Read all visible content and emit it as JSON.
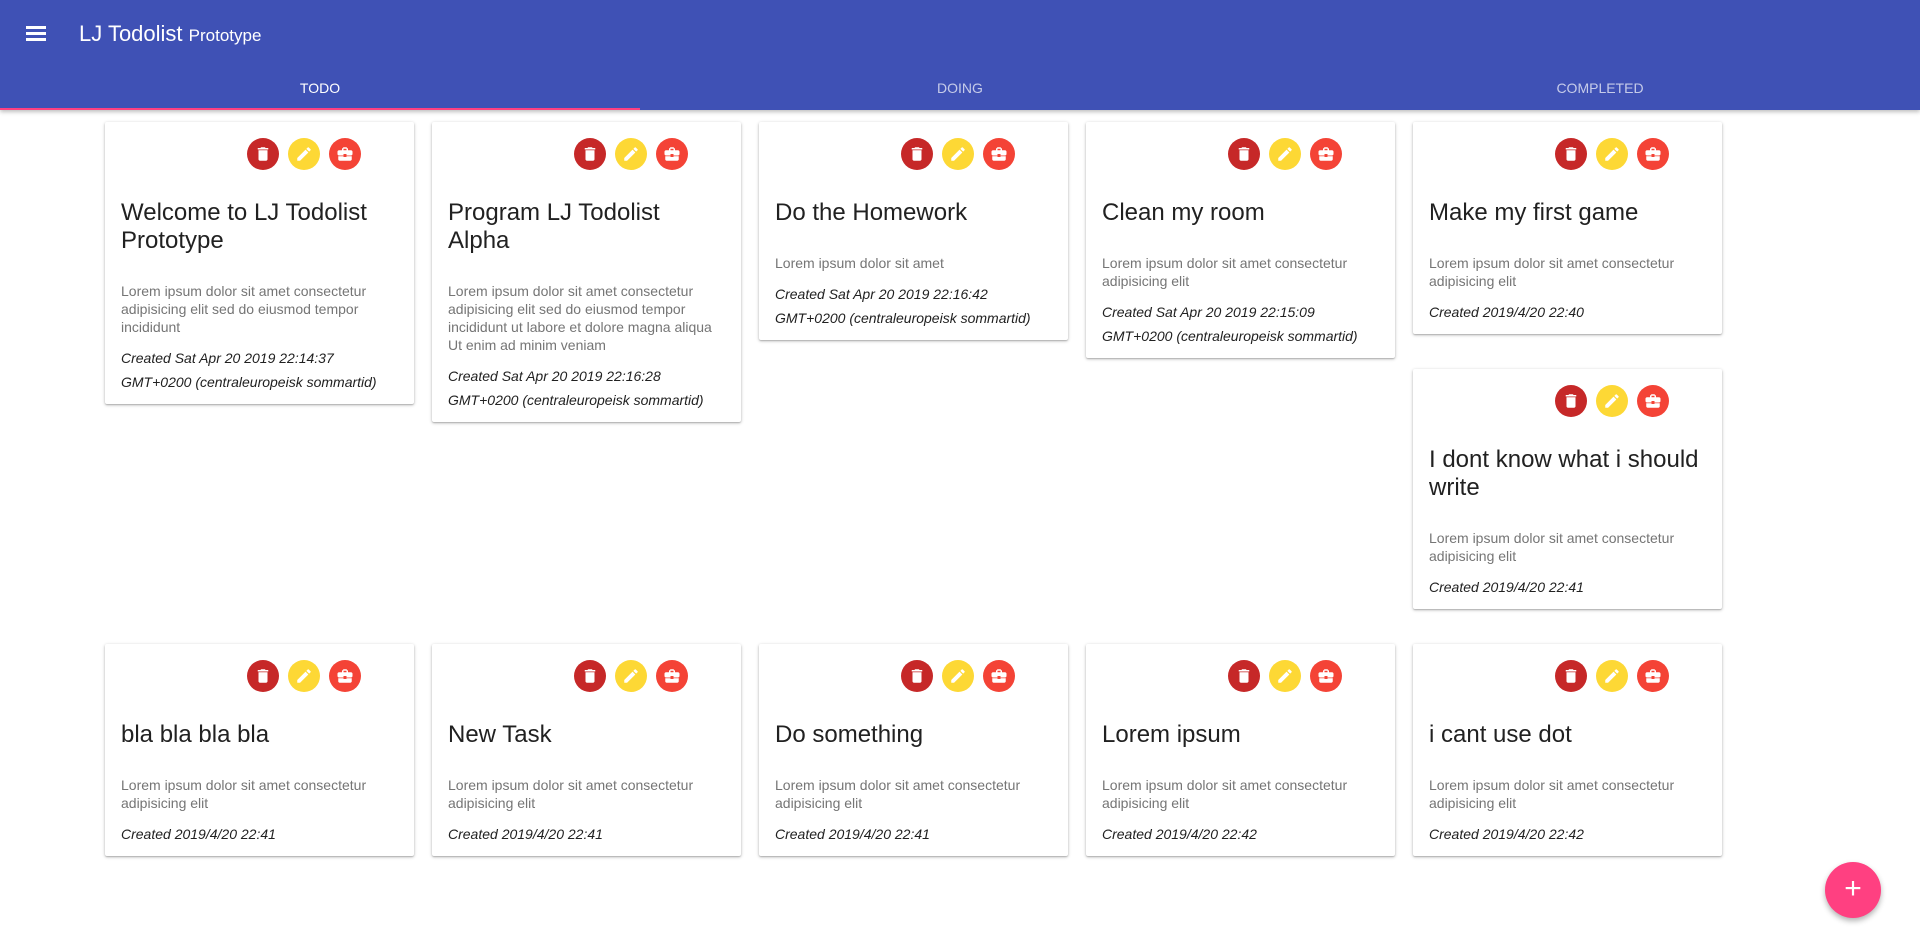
{
  "app": {
    "title": "LJ Todolist",
    "subtitle": "Prototype"
  },
  "tabs": [
    {
      "label": "TODO"
    },
    {
      "label": "DOING"
    },
    {
      "label": "COMPLETED"
    }
  ],
  "colors": {
    "appbar": "#3f51b5",
    "tab_indicator": "#ff4081",
    "delete": "#c62828",
    "edit": "#fdd835",
    "move": "#f44336",
    "fab": "#ff4081"
  },
  "card_icons": [
    "delete-icon",
    "edit-icon",
    "briefcase-icon"
  ],
  "cards": [
    {
      "title": "Welcome to LJ Todolist Prototype",
      "body": "Lorem ipsum dolor sit amet consectetur adipisicing elit sed do eiusmod tempor incididunt",
      "date": "Created Sat Apr 20 2019 22:14:37 GMT+0200 (centraleuropeisk sommartid)"
    },
    {
      "title": "Program LJ Todolist Alpha",
      "body": "Lorem ipsum dolor sit amet consectetur adipisicing elit sed do eiusmod tempor incididunt ut labore et dolore magna aliqua Ut enim ad minim veniam",
      "date": "Created Sat Apr 20 2019 22:16:28 GMT+0200 (centraleuropeisk sommartid)"
    },
    {
      "title": "Do the Homework",
      "body": "Lorem ipsum dolor sit amet",
      "date": "Created Sat Apr 20 2019 22:16:42 GMT+0200 (centraleuropeisk sommartid)"
    },
    {
      "title": "Clean my room",
      "body": "Lorem ipsum dolor sit amet consectetur adipisicing elit",
      "date": "Created Sat Apr 20 2019 22:15:09 GMT+0200 (centraleuropeisk sommartid)"
    },
    {
      "title": "Make my first game",
      "body": "Lorem ipsum dolor sit amet consectetur adipisicing elit",
      "date": "Created 2019/4/20 22:40"
    },
    {
      "title": "I dont know what i should write",
      "body": "Lorem ipsum dolor sit amet consectetur adipisicing elit",
      "date": "Created 2019/4/20 22:41"
    },
    {
      "title": "bla bla bla bla",
      "body": "Lorem ipsum dolor sit amet consectetur adipisicing elit",
      "date": "Created 2019/4/20 22:41"
    },
    {
      "title": "New Task",
      "body": "Lorem ipsum dolor sit amet consectetur adipisicing elit",
      "date": "Created 2019/4/20 22:41"
    },
    {
      "title": "Do something",
      "body": "Lorem ipsum dolor sit amet consectetur adipisicing elit",
      "date": "Created 2019/4/20 22:41"
    },
    {
      "title": "Lorem ipsum",
      "body": "Lorem ipsum dolor sit amet consectetur adipisicing elit",
      "date": "Created 2019/4/20 22:42"
    },
    {
      "title": "i cant use dot",
      "body": "Lorem ipsum dolor sit amet consectetur adipisicing elit",
      "date": "Created 2019/4/20 22:42"
    }
  ],
  "fab": {
    "label": "+"
  }
}
